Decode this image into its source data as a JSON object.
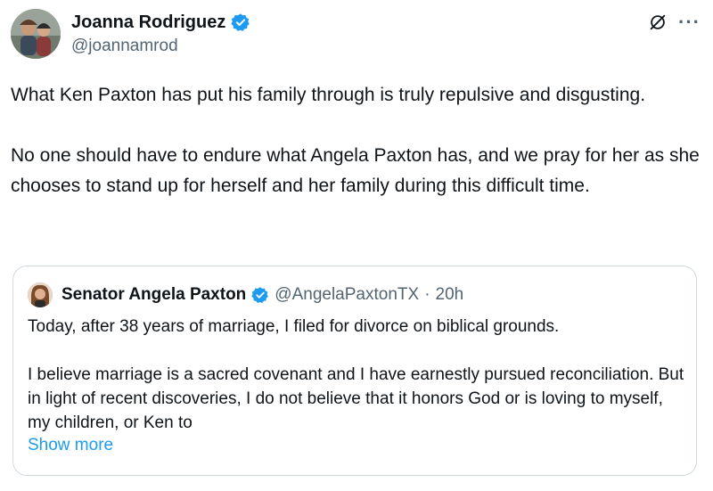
{
  "author": {
    "display_name": "Joanna Rodriguez",
    "handle": "@joannamrod",
    "verified": true
  },
  "icons": {
    "verified": "verified-badge-icon",
    "grok": "grok-icon",
    "more": "more-options-icon"
  },
  "colors": {
    "verified_blue": "#1d9bf0",
    "link_blue": "#1d9bf0",
    "secondary_text": "#536471",
    "border": "#cfd9de"
  },
  "tweet": {
    "paragraphs": [
      "What Ken Paxton has put his family through is truly repulsive and disgusting.",
      "No one should have to endure what Angela Paxton has, and we pray for her as she chooses to stand up for herself and her family during this difficult time."
    ]
  },
  "quoted_tweet": {
    "display_name": "Senator Angela Paxton",
    "verified": true,
    "handle": "@AngelaPaxtonTX",
    "separator": "·",
    "time": "20h",
    "paragraphs": [
      "Today, after 38 years of marriage, I filed for divorce on biblical grounds.",
      "I believe marriage is a sacred covenant and I have earnestly pursued reconciliation. But in light of recent discoveries, I do not believe that it honors God or is loving to myself, my children, or Ken to"
    ],
    "show_more_label": "Show more"
  }
}
